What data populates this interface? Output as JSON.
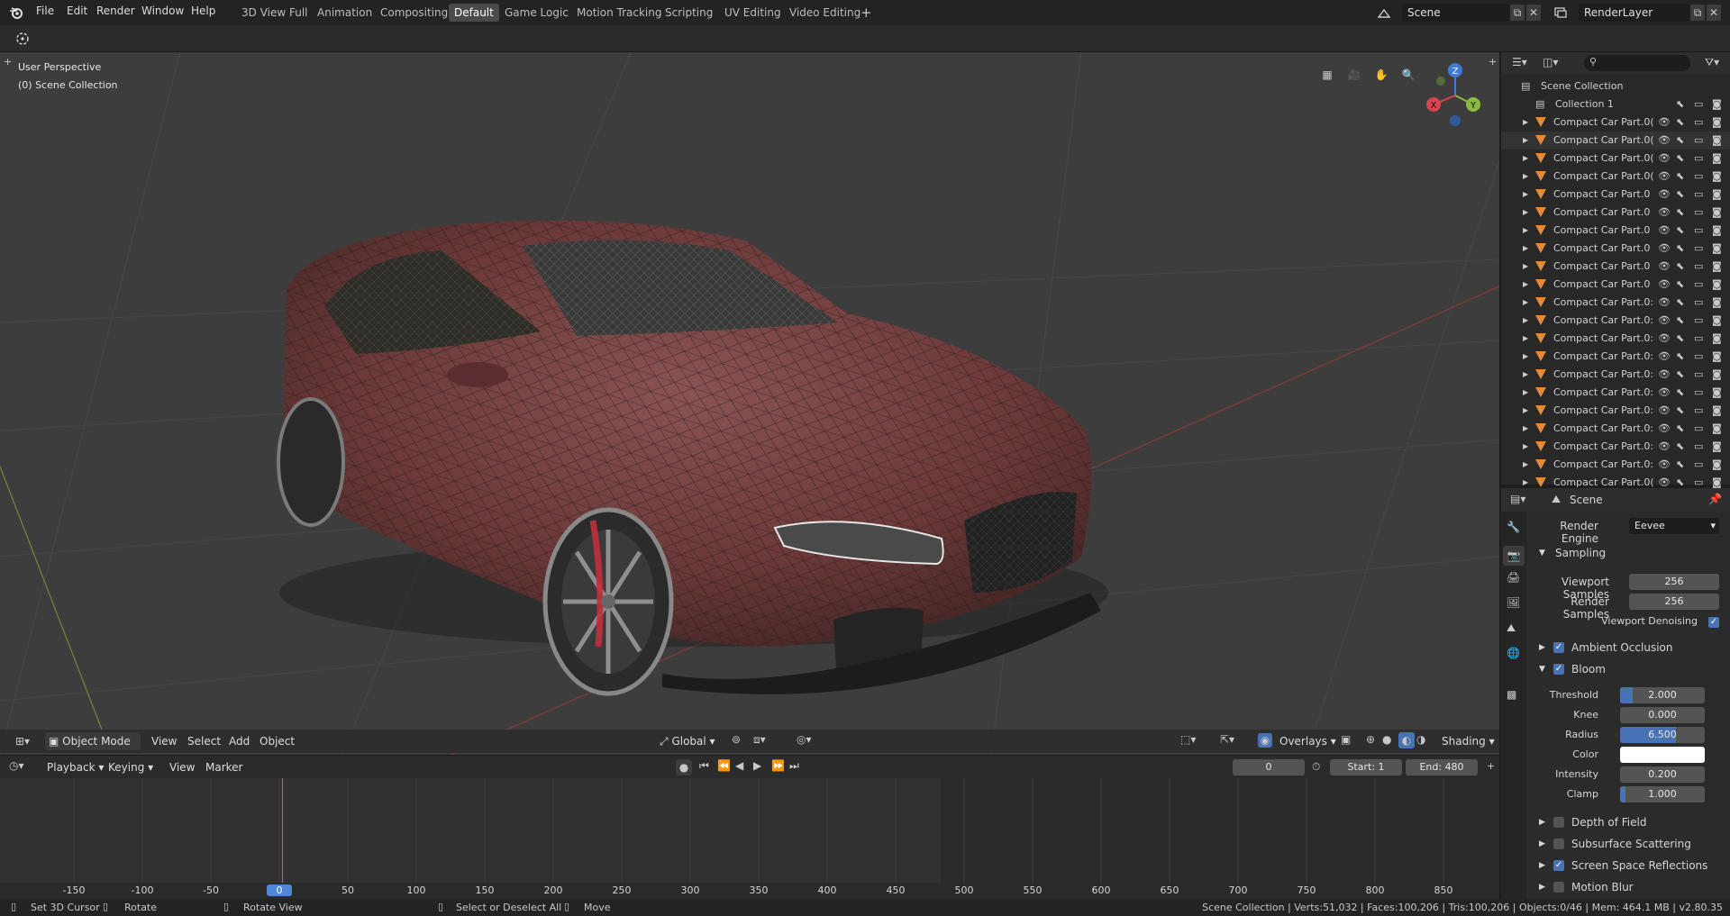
{
  "menu": {
    "items": [
      "File",
      "Edit",
      "Render",
      "Window",
      "Help"
    ]
  },
  "workspace_tabs": [
    "3D View Full",
    "Animation",
    "Compositing",
    "Default",
    "Game Logic",
    "Motion Tracking",
    "Scripting",
    "UV Editing",
    "Video Editing"
  ],
  "active_tab": "Default",
  "scene_selector": {
    "value": "Scene"
  },
  "layer_selector": {
    "value": "RenderLayer"
  },
  "viewport": {
    "perspective_label": "User Perspective",
    "collection_label": "(0) Scene Collection",
    "axis_x": "X",
    "axis_y": "Y",
    "axis_z": "Z"
  },
  "viewport_header": {
    "mode": "Object Mode",
    "view": "View",
    "select": "Select",
    "add": "Add",
    "object": "Object",
    "transform_orientation": "Global",
    "overlays": "Overlays",
    "shading": "Shading"
  },
  "timeline_header": {
    "playback": "Playback",
    "keying": "Keying",
    "view": "View",
    "marker": "Marker",
    "current_frame": "0",
    "start_label": "Start:",
    "start_value": "1",
    "end_label": "End:",
    "end_value": "480"
  },
  "timeline_ruler": [
    "-150",
    "-100",
    "-50",
    "0",
    "50",
    "100",
    "150",
    "200",
    "250",
    "300",
    "350",
    "400",
    "450",
    "500",
    "550",
    "600",
    "650",
    "700",
    "750",
    "800",
    "850"
  ],
  "outliner": {
    "root": "Scene Collection",
    "collection": "Collection 1",
    "items": [
      "Compact Car Part.0(",
      "Compact Car Part.0(",
      "Compact Car Part.0(",
      "Compact Car Part.0(",
      "Compact Car Part.0",
      "Compact Car Part.0",
      "Compact Car Part.0",
      "Compact Car Part.0",
      "Compact Car Part.0",
      "Compact Car Part.0",
      "Compact Car Part.0:",
      "Compact Car Part.0:",
      "Compact Car Part.0:",
      "Compact Car Part.0:",
      "Compact Car Part.0:",
      "Compact Car Part.0:",
      "Compact Car Part.0:",
      "Compact Car Part.0:",
      "Compact Car Part.0:",
      "Compact Car Part.0:",
      "Compact Car Part.0("
    ]
  },
  "properties": {
    "context": "Scene",
    "render_engine_label": "Render Engine",
    "render_engine_value": "Eevee",
    "sampling": "Sampling",
    "viewport_samples_label": "Viewport Samples",
    "viewport_samples": "256",
    "render_samples_label": "Render Samples",
    "render_samples": "256",
    "viewport_denoising": "Viewport Denoising",
    "ambient_occlusion": "Ambient Occlusion",
    "bloom": "Bloom",
    "threshold_label": "Threshold",
    "threshold": "2.000",
    "knee_label": "Knee",
    "knee": "0.000",
    "radius_label": "Radius",
    "radius": "6.500",
    "color_label": "Color",
    "intensity_label": "Intensity",
    "intensity": "0.200",
    "clamp_label": "Clamp",
    "clamp": "1.000",
    "depth_of_field": "Depth of Field",
    "subsurface_scattering": "Subsurface Scattering",
    "screen_space_reflections": "Screen Space Reflections",
    "motion_blur": "Motion Blur"
  },
  "statusbar": {
    "set_cursor": "Set 3D Cursor",
    "rotate": "Rotate",
    "rotate_view": "Rotate View",
    "select_deselect": "Select or Deselect All",
    "move": "Move",
    "stats": "Scene Collection | Verts:51,032 | Faces:100,206 | Tris:100,206 | Objects:0/46 | Mem: 464.1 MB | v2.80.35"
  },
  "colors": {
    "accent_blue": "#4772b3",
    "active_tab": "#4a4a4a",
    "car_body": "#6e3a3a",
    "playhead": "#4f87d6"
  }
}
